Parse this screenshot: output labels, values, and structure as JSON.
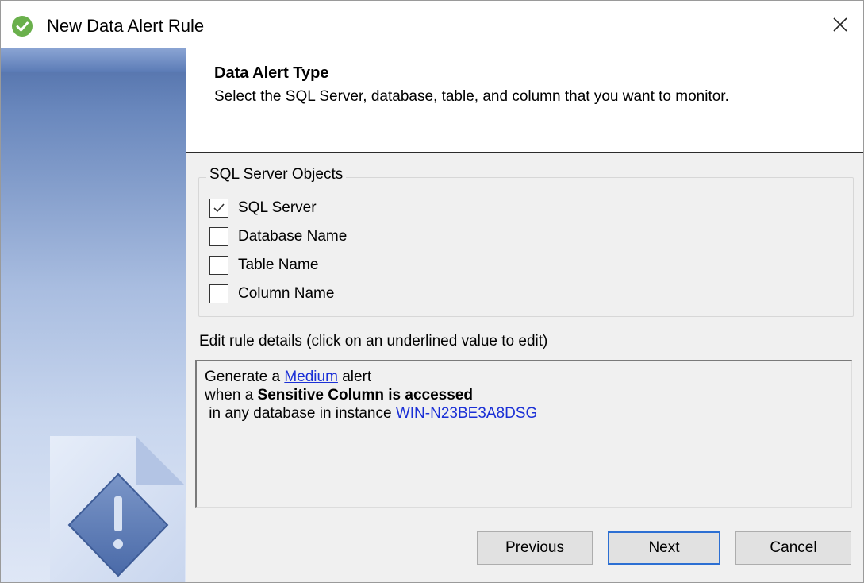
{
  "window": {
    "title": "New Data Alert Rule",
    "app_icon": "green-check-circle-icon",
    "close_icon": "close-icon"
  },
  "header": {
    "title": "Data Alert Type",
    "subtitle": "Select the SQL Server, database, table, and column that you want to monitor."
  },
  "objects": {
    "legend": "SQL Server Objects",
    "items": [
      {
        "label": "SQL Server",
        "checked": true
      },
      {
        "label": "Database Name",
        "checked": false
      },
      {
        "label": "Table Name",
        "checked": false
      },
      {
        "label": "Column Name",
        "checked": false
      }
    ]
  },
  "details": {
    "label": "Edit rule details (click on an underlined value to edit)",
    "line1_prefix": "Generate a ",
    "line1_link": "Medium",
    "line1_suffix": " alert",
    "line2_prefix": "when a ",
    "line2_bold": "Sensitive Column is accessed",
    "line3_prefix": " in any database in instance ",
    "line3_link": "WIN-N23BE3A8DSG"
  },
  "buttons": {
    "previous": "Previous",
    "next": "Next",
    "cancel": "Cancel"
  },
  "colors": {
    "link": "#1a2fd6",
    "banner": "#6a88bd",
    "primary_border": "#2c6fd3"
  }
}
